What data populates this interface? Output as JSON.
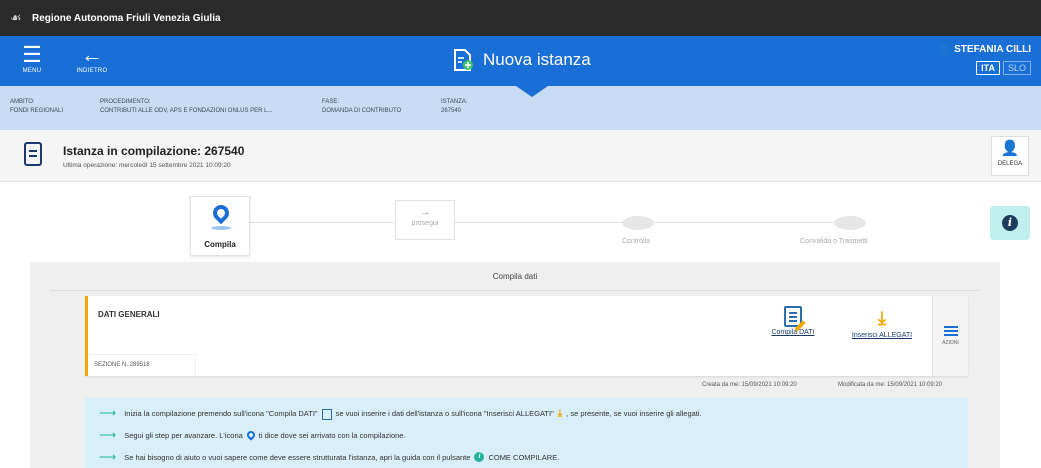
{
  "topbar": {
    "region_name": "Regione Autonoma Friuli Venezia Giulia"
  },
  "header": {
    "menu_label": "MENU",
    "back_label": "INDIETRO",
    "title": "Nuova istanza",
    "user_name": "STEFANIA CILLI",
    "languages": [
      "ITA",
      "SLO"
    ],
    "brand_color": "#1a6fd6"
  },
  "breadcrumb": [
    {
      "key": "AMBITO:",
      "value": "FONDI REGIONALI"
    },
    {
      "key": "PROCEDIMENTO:",
      "value": "CONTRIBUTI ALLE ODV, APS E FONDAZIONI ONLUS PER L..."
    },
    {
      "key": "FASE:",
      "value": "DOMANDA DI CONTRIBUTO"
    },
    {
      "key": "ISTANZA:",
      "value": "267540"
    }
  ],
  "instance": {
    "title": "Istanza in compilazione: 267540",
    "last_operation": "Ultima operazione: mercoledì 15 settembre 2021 10:09:20",
    "delega_label": "DELEGA"
  },
  "stepper": {
    "steps": [
      "Compila",
      "Controlla",
      "Convalida o Trasmetti"
    ],
    "prosegui_label": "prosegui"
  },
  "content": {
    "section_title": "Compila dati",
    "card": {
      "title": "DATI GENERALI",
      "section_number": "SEZIONE N. 289518",
      "compila_label": "Compila DATI",
      "allegati_label": "Inserisci ALLEGATI",
      "menu_label": "AZIONI"
    },
    "created_by": "Creata da me: 15/09/2021 10:09:20",
    "modified_by": "Modificata da me: 15/09/2021 10:09:20",
    "tips": {
      "tip1_a": "Inizia la compilazione premendo sull'icona \"Compila DATI\"",
      "tip1_b": "se vuoi inserire i dati dell'istanza o sull'icona \"Inserisci ALLEGATI\"",
      "tip1_c": ", se presente, se vuoi inserire gli allegati.",
      "tip2_a": "Segui gli step per avanzare. L'icona",
      "tip2_b": "ti dice dove sei arrivato con la compilazione.",
      "tip3_a": "Se hai bisogno di aiuto o vuoi sapere come deve essere strutturata l'istanza, apri la guida con il pulsante",
      "tip3_b": "COME COMPILARE."
    }
  }
}
